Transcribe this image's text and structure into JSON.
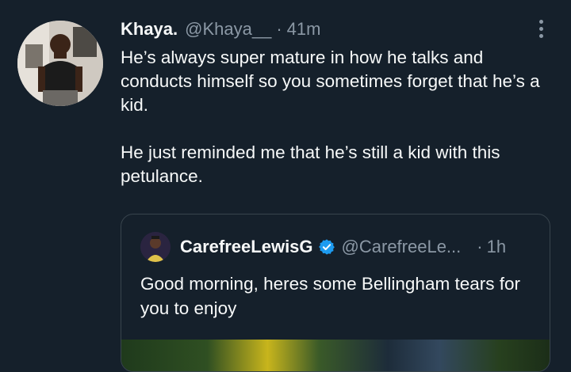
{
  "tweet": {
    "display_name": "Khaya.",
    "handle": "@Khaya__",
    "separator": "·",
    "time": "41m",
    "text_paragraphs": [
      "He’s always super mature in how he talks and conducts himself so you sometimes forget that he’s a kid.",
      "He just reminded me that he’s still a kid with this petulance."
    ]
  },
  "quote": {
    "display_name": "CarefreeLewisG",
    "handle": "@CarefreeLe...",
    "separator": "·",
    "time": "1h",
    "verified": true,
    "text": "Good morning, heres some Bellingham tears for you to enjoy"
  },
  "icons": {
    "more": "more-options-icon",
    "verified": "verified-badge-icon"
  },
  "colors": {
    "background": "#15202b",
    "text_primary": "#f7f9f9",
    "text_secondary": "#8b98a5",
    "border": "#38444d",
    "verified_blue": "#1d9bf0"
  }
}
